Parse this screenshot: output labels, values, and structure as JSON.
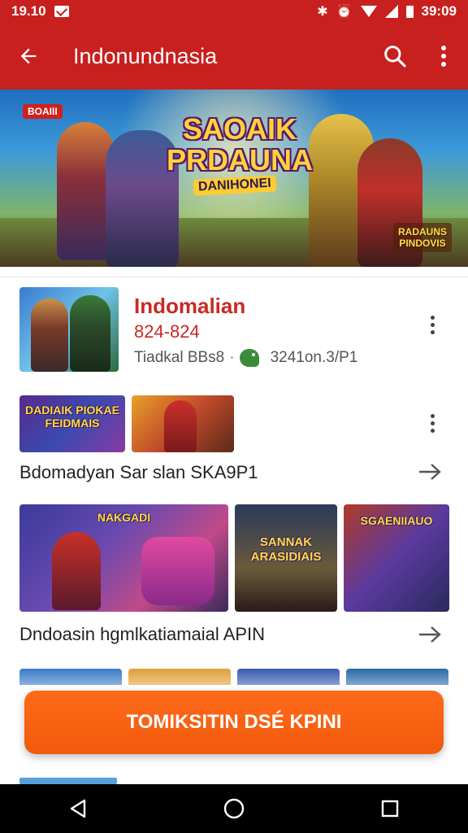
{
  "status_bar": {
    "time": "19.10",
    "clock_right": "39:09",
    "icons": [
      "mail-icon",
      "bluetooth-icon",
      "alarm-icon",
      "wifi-icon",
      "signal-icon",
      "battery-icon"
    ]
  },
  "app_bar": {
    "title": "Indonundnasia",
    "back_icon": "arrow-back-icon",
    "search_icon": "search-icon",
    "menu_icon": "more-vert-icon",
    "color": "#c8201e"
  },
  "hero": {
    "title": "SAOAIK PRDAUNA",
    "subtitle": "DANIHONEI",
    "badge": "BOAIII",
    "corner_label": "RADAUNS PINDOVIS"
  },
  "featured": {
    "name": "Indomalian",
    "version": "824-824",
    "meta_left": "Tiadkal BBs8",
    "separator": "·",
    "meta_right": "3241on.3/P1"
  },
  "row1": {
    "thumbs": [
      {
        "label": "DADIAIK PIOKAE FEIDMAIS"
      },
      {
        "label": ""
      }
    ],
    "label": "Bdomadyan Sar slan SKA9P1"
  },
  "row2": {
    "thumbs": [
      {
        "label": "NAKGADI"
      },
      {
        "label": "SANNAK ARASIDIAIS"
      },
      {
        "label": "SGAENIIAUO"
      }
    ],
    "label": "Dndoasin hgmlkatiamaial APIN"
  },
  "cta": {
    "label": "TOMIKSITIN DSÉ KPINI",
    "color": "#f15a0c"
  },
  "nav_bar": {
    "icons": [
      "back-triangle-icon",
      "home-circle-icon",
      "recents-square-icon"
    ]
  }
}
